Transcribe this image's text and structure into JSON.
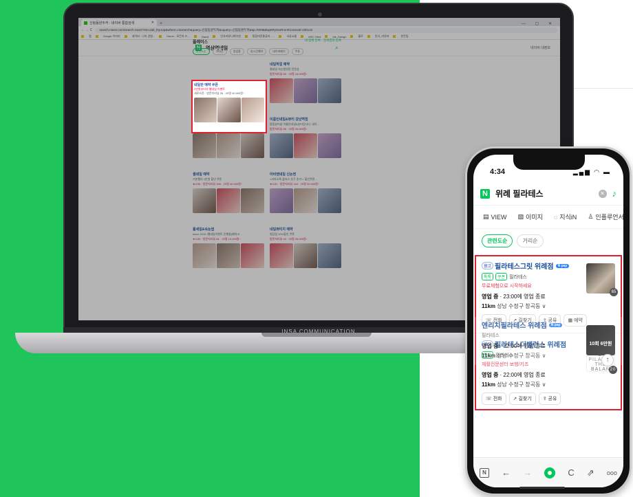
{
  "laptop": {
    "brand": "INSA COMMUNICATION",
    "browser": {
      "tab_title": "신림동원두커 : 네이버 통합검색",
      "tab_new": "+",
      "window_controls": "— ▢ ✕",
      "nav_icons": "← → C",
      "url": "search.naver.com/search.naver?sm=tab_hty.top&where=nexearch&query=신림동원두커&oquery=신림동원두커&tqi=h0MBdwp5Ry0ssRrnnR1sssssE-236142",
      "bookmarks": [
        "앱",
        "Google 이미지",
        "네이버 : 나의 경험...",
        "Daum - 모든의 즈...",
        "Gaudi",
        "인사커뮤니케이션",
        "통합마준통류자 - ...",
        "서류쇼룸",
        "MSC Html",
        "Ink_Design",
        "블로",
        "인사_커뮤마",
        "한잔팁"
      ]
    },
    "naver": {
      "query": "역삼역네일",
      "right": "네이버 내정보",
      "place_title": "플레이스",
      "place_more": "내 업체 등록 · 검색결과 등록",
      "filters": [
        "관련도순",
        "거리순",
        "영업중",
        "실시간예약",
        "네이버페이",
        "쿠폰"
      ],
      "highlighted": {
        "title": "네일한 예약 쿠폰",
        "ad": "2만원부터의 젤네일 이벤트",
        "meta": "새로오픈 · 방문자리뷰 26 · 20명 40,000원~"
      },
      "cards": [
        {
          "title": "네일하걸 예약",
          "line": "젤네일 속눈썹연장 전문샵",
          "meta": "방문자리뷰 83 · 20명 15,000원~"
        },
        {
          "title": "프린세일 예약",
          "line": "마알이벤트 30000 시작해 새로운 디자인 제...",
          "meta": "★4.56 · 방문자리뷰 406 · 20명 15,000원~"
        },
        {
          "title": "이룸인네일&뷰티 강남역점",
          "line": "종합뷰티샵 이룸인네일&뷰티입니다. 네이...",
          "meta": "방문자리뷰 85 · 20명 20,000원~"
        },
        {
          "title": "셀네일 예약",
          "line": "기본젤의 1만원 할인 쿠폰",
          "meta": "★4.96 · 방문자리뷰 306 · 20명 40,000원~"
        },
        {
          "title": "아비앤네일 신논현",
          "line": "<카카오톡 플러스 친구 추가 > 할인쿠폰...",
          "meta": "★4.81 · 방문자리뷰 154 · 20명 20,000원~"
        },
        {
          "title": "룰세일&속눈썹",
          "line": "since 2019 /젤네일이벤트 진행중(예약고 ...",
          "meta": "★4.89 · 방문자리뷰 81 · 20명 10,000원~"
        },
        {
          "title": "네일뷰티지 예약",
          "line": "청담점 10%할인 쿠폰",
          "meta": "방문자리뷰 40 · 20명 25,000원~"
        }
      ]
    }
  },
  "phone": {
    "time": "4:34",
    "status_icons": "▂▄▆ ◠ ▬",
    "query": "위례 필라테스",
    "clear_icon": "✕",
    "mic_icon": "🎙",
    "tabs": [
      {
        "icon": "▤",
        "label": "VIEW"
      },
      {
        "icon": "▧",
        "label": "이미지"
      },
      {
        "icon": "◌",
        "label": "지식iN"
      },
      {
        "icon": "♙",
        "label": "인플루언서"
      }
    ],
    "sort": [
      "관련도순",
      "거리순"
    ],
    "cards": [
      {
        "ad": "광고",
        "title": "필라테스그릿 위례점",
        "npay": "N pay",
        "badge_a": "톡톡",
        "badge_b": "쿠폰",
        "category": "필라테스",
        "promo": "무료체험으로 시작하세요",
        "status": "영업 중",
        "hours": " · 23:00에 영업 종료",
        "distance": "11km",
        "address": "성남 수정구 창곡동 ∨",
        "actions": [
          "☏ 전화",
          "➚ 길찾기",
          "⇪ 공유",
          "▦ 예약"
        ],
        "thumb_count": "65",
        "thumb_label": ""
      },
      {
        "ad": "광고",
        "title": "필라테스더밸런스 위례점",
        "npay": "",
        "badge_a": "톡톡",
        "badge_b": "",
        "category": "필라테스",
        "promo": "재활전문센터 보행/키즈",
        "status": "영업 중",
        "hours": " · 22:00에 영업 종료",
        "distance": "11km",
        "address": "성남 수정구 창곡동 ∨",
        "actions": [
          "☏ 전화",
          "➚ 길찾기",
          "⇪ 공유"
        ],
        "thumb_count": "20",
        "thumb_label": "PILATES THE BALAN"
      },
      {
        "title": "엔리치필라테스 위례점",
        "npay": "N pay",
        "category": "필라테스",
        "status": "영업 중",
        "hours": " · 22:00에 영업 종료",
        "distance": "11km",
        "address": "성남 수정구 창곡동 ∨",
        "thumb_label": "10회 6만원"
      }
    ],
    "up_icon": "↑",
    "nav": {
      "n": "N",
      "back": "←",
      "forward": "→",
      "refresh": "C",
      "share": "⇗",
      "more": "ooo"
    }
  }
}
